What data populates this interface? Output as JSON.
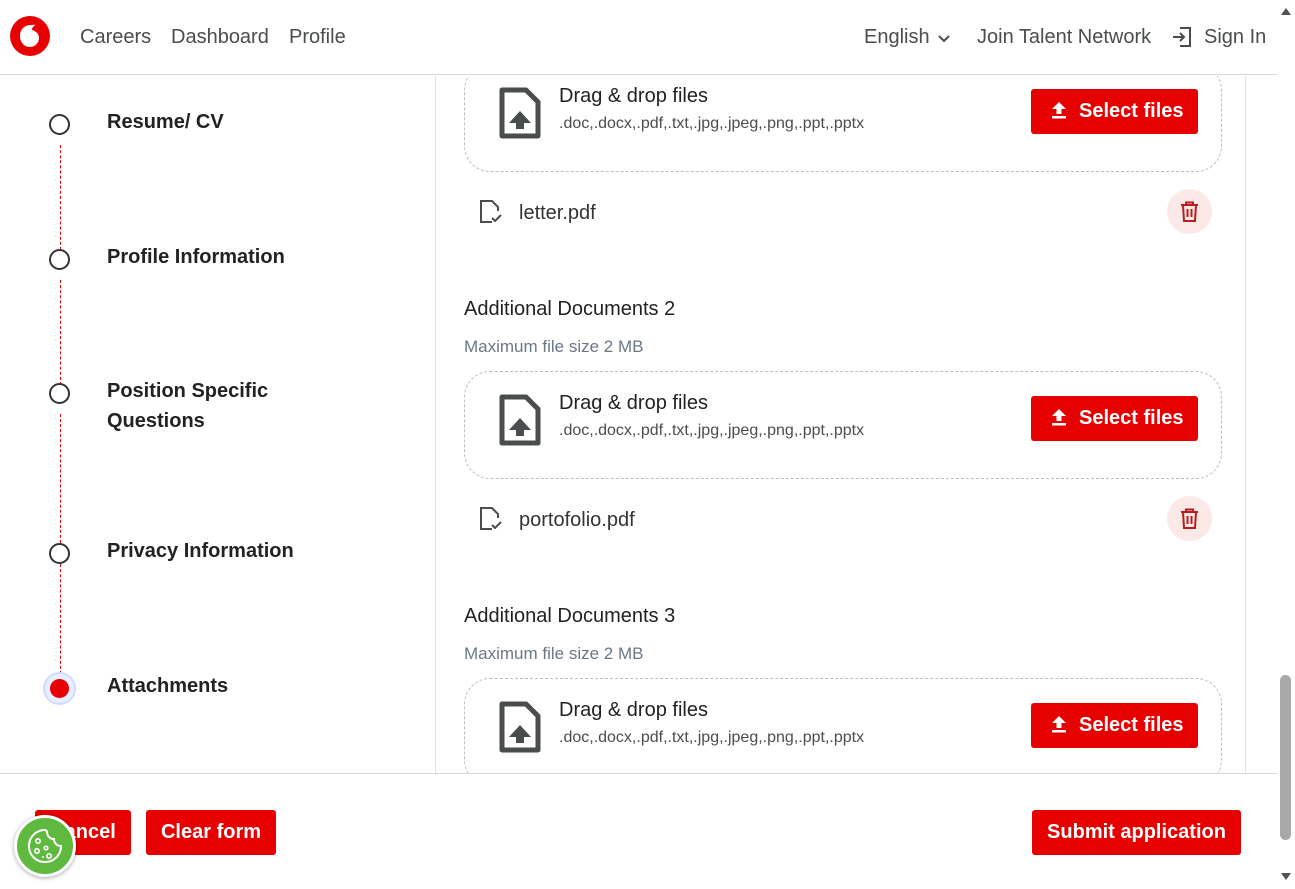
{
  "header": {
    "logo_icon": "vodafone-logo-icon",
    "nav": [
      "Careers",
      "Dashboard",
      "Profile"
    ],
    "language": "English",
    "join_label": "Join Talent Network",
    "signin_label": "Sign In"
  },
  "steps": [
    {
      "label": "Resume/ CV",
      "state": "incomplete"
    },
    {
      "label": "Profile Information",
      "state": "incomplete"
    },
    {
      "label": "Position Specific Questions",
      "state": "incomplete"
    },
    {
      "label": "Privacy Information",
      "state": "incomplete"
    },
    {
      "label": "Attachments",
      "state": "active"
    }
  ],
  "dropzone": {
    "title": "Drag & drop files",
    "types": ".doc,.docx,.pdf,.txt,.jpg,.jpeg,.png,.ppt,.pptx",
    "button_label": "Select files"
  },
  "sections": [
    {
      "file": "letter.pdf"
    },
    {
      "title": "Additional Documents 2",
      "hint": "Maximum file size 2 MB",
      "file": "portofolio.pdf"
    },
    {
      "title": "Additional Documents 3",
      "hint": "Maximum file size 2 MB"
    }
  ],
  "footer": {
    "cancel_label": "Cancel",
    "clear_label": "Clear form",
    "submit_label": "Submit application"
  },
  "colors": {
    "brand_red": "#e60000",
    "cookie_green": "#5fb93f"
  }
}
